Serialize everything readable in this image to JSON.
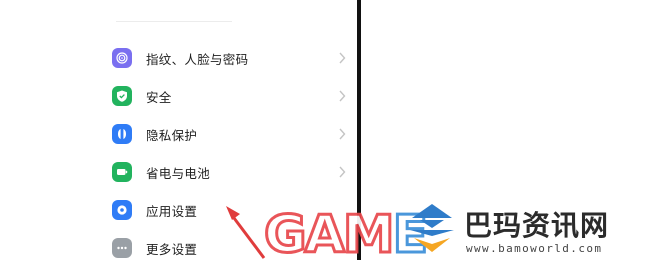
{
  "settings": {
    "items": [
      {
        "label": "指纹、人脸与密码",
        "icon": "fingerprint-icon",
        "color": "#7a6ff0"
      },
      {
        "label": "安全",
        "icon": "shield-icon",
        "color": "#22b35e"
      },
      {
        "label": "隐私保护",
        "icon": "privacy-icon",
        "color": "#2f7cf6"
      },
      {
        "label": "省电与电池",
        "icon": "battery-icon",
        "color": "#22b35e"
      },
      {
        "label": "应用设置",
        "icon": "gear-icon",
        "color": "#2f7cf6"
      },
      {
        "label": "更多设置",
        "icon": "more-icon",
        "color": "#9aa0a6"
      }
    ]
  },
  "watermark": {
    "text_main": "GAM",
    "text_last": "E",
    "colors": {
      "outline": "#e8474b",
      "accent": "#3b8fd9"
    }
  },
  "brand": {
    "name": "巴玛资讯网",
    "url": "www.bamoworld.com",
    "colors": {
      "top": "#2f7cc9",
      "bottom": "#f5a623"
    }
  }
}
